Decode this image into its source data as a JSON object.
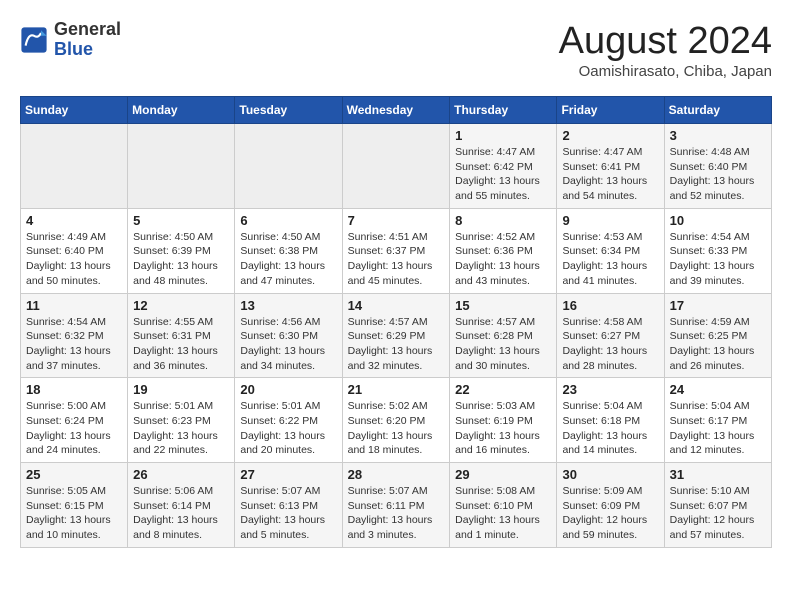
{
  "header": {
    "logo_general": "General",
    "logo_blue": "Blue",
    "title": "August 2024",
    "subtitle": "Oamishirasato, Chiba, Japan"
  },
  "weekdays": [
    "Sunday",
    "Monday",
    "Tuesday",
    "Wednesday",
    "Thursday",
    "Friday",
    "Saturday"
  ],
  "weeks": [
    [
      {
        "day": "",
        "info": ""
      },
      {
        "day": "",
        "info": ""
      },
      {
        "day": "",
        "info": ""
      },
      {
        "day": "",
        "info": ""
      },
      {
        "day": "1",
        "info": "Sunrise: 4:47 AM\nSunset: 6:42 PM\nDaylight: 13 hours\nand 55 minutes."
      },
      {
        "day": "2",
        "info": "Sunrise: 4:47 AM\nSunset: 6:41 PM\nDaylight: 13 hours\nand 54 minutes."
      },
      {
        "day": "3",
        "info": "Sunrise: 4:48 AM\nSunset: 6:40 PM\nDaylight: 13 hours\nand 52 minutes."
      }
    ],
    [
      {
        "day": "4",
        "info": "Sunrise: 4:49 AM\nSunset: 6:40 PM\nDaylight: 13 hours\nand 50 minutes."
      },
      {
        "day": "5",
        "info": "Sunrise: 4:50 AM\nSunset: 6:39 PM\nDaylight: 13 hours\nand 48 minutes."
      },
      {
        "day": "6",
        "info": "Sunrise: 4:50 AM\nSunset: 6:38 PM\nDaylight: 13 hours\nand 47 minutes."
      },
      {
        "day": "7",
        "info": "Sunrise: 4:51 AM\nSunset: 6:37 PM\nDaylight: 13 hours\nand 45 minutes."
      },
      {
        "day": "8",
        "info": "Sunrise: 4:52 AM\nSunset: 6:36 PM\nDaylight: 13 hours\nand 43 minutes."
      },
      {
        "day": "9",
        "info": "Sunrise: 4:53 AM\nSunset: 6:34 PM\nDaylight: 13 hours\nand 41 minutes."
      },
      {
        "day": "10",
        "info": "Sunrise: 4:54 AM\nSunset: 6:33 PM\nDaylight: 13 hours\nand 39 minutes."
      }
    ],
    [
      {
        "day": "11",
        "info": "Sunrise: 4:54 AM\nSunset: 6:32 PM\nDaylight: 13 hours\nand 37 minutes."
      },
      {
        "day": "12",
        "info": "Sunrise: 4:55 AM\nSunset: 6:31 PM\nDaylight: 13 hours\nand 36 minutes."
      },
      {
        "day": "13",
        "info": "Sunrise: 4:56 AM\nSunset: 6:30 PM\nDaylight: 13 hours\nand 34 minutes."
      },
      {
        "day": "14",
        "info": "Sunrise: 4:57 AM\nSunset: 6:29 PM\nDaylight: 13 hours\nand 32 minutes."
      },
      {
        "day": "15",
        "info": "Sunrise: 4:57 AM\nSunset: 6:28 PM\nDaylight: 13 hours\nand 30 minutes."
      },
      {
        "day": "16",
        "info": "Sunrise: 4:58 AM\nSunset: 6:27 PM\nDaylight: 13 hours\nand 28 minutes."
      },
      {
        "day": "17",
        "info": "Sunrise: 4:59 AM\nSunset: 6:25 PM\nDaylight: 13 hours\nand 26 minutes."
      }
    ],
    [
      {
        "day": "18",
        "info": "Sunrise: 5:00 AM\nSunset: 6:24 PM\nDaylight: 13 hours\nand 24 minutes."
      },
      {
        "day": "19",
        "info": "Sunrise: 5:01 AM\nSunset: 6:23 PM\nDaylight: 13 hours\nand 22 minutes."
      },
      {
        "day": "20",
        "info": "Sunrise: 5:01 AM\nSunset: 6:22 PM\nDaylight: 13 hours\nand 20 minutes."
      },
      {
        "day": "21",
        "info": "Sunrise: 5:02 AM\nSunset: 6:20 PM\nDaylight: 13 hours\nand 18 minutes."
      },
      {
        "day": "22",
        "info": "Sunrise: 5:03 AM\nSunset: 6:19 PM\nDaylight: 13 hours\nand 16 minutes."
      },
      {
        "day": "23",
        "info": "Sunrise: 5:04 AM\nSunset: 6:18 PM\nDaylight: 13 hours\nand 14 minutes."
      },
      {
        "day": "24",
        "info": "Sunrise: 5:04 AM\nSunset: 6:17 PM\nDaylight: 13 hours\nand 12 minutes."
      }
    ],
    [
      {
        "day": "25",
        "info": "Sunrise: 5:05 AM\nSunset: 6:15 PM\nDaylight: 13 hours\nand 10 minutes."
      },
      {
        "day": "26",
        "info": "Sunrise: 5:06 AM\nSunset: 6:14 PM\nDaylight: 13 hours\nand 8 minutes."
      },
      {
        "day": "27",
        "info": "Sunrise: 5:07 AM\nSunset: 6:13 PM\nDaylight: 13 hours\nand 5 minutes."
      },
      {
        "day": "28",
        "info": "Sunrise: 5:07 AM\nSunset: 6:11 PM\nDaylight: 13 hours\nand 3 minutes."
      },
      {
        "day": "29",
        "info": "Sunrise: 5:08 AM\nSunset: 6:10 PM\nDaylight: 13 hours\nand 1 minute."
      },
      {
        "day": "30",
        "info": "Sunrise: 5:09 AM\nSunset: 6:09 PM\nDaylight: 12 hours\nand 59 minutes."
      },
      {
        "day": "31",
        "info": "Sunrise: 5:10 AM\nSunset: 6:07 PM\nDaylight: 12 hours\nand 57 minutes."
      }
    ]
  ]
}
